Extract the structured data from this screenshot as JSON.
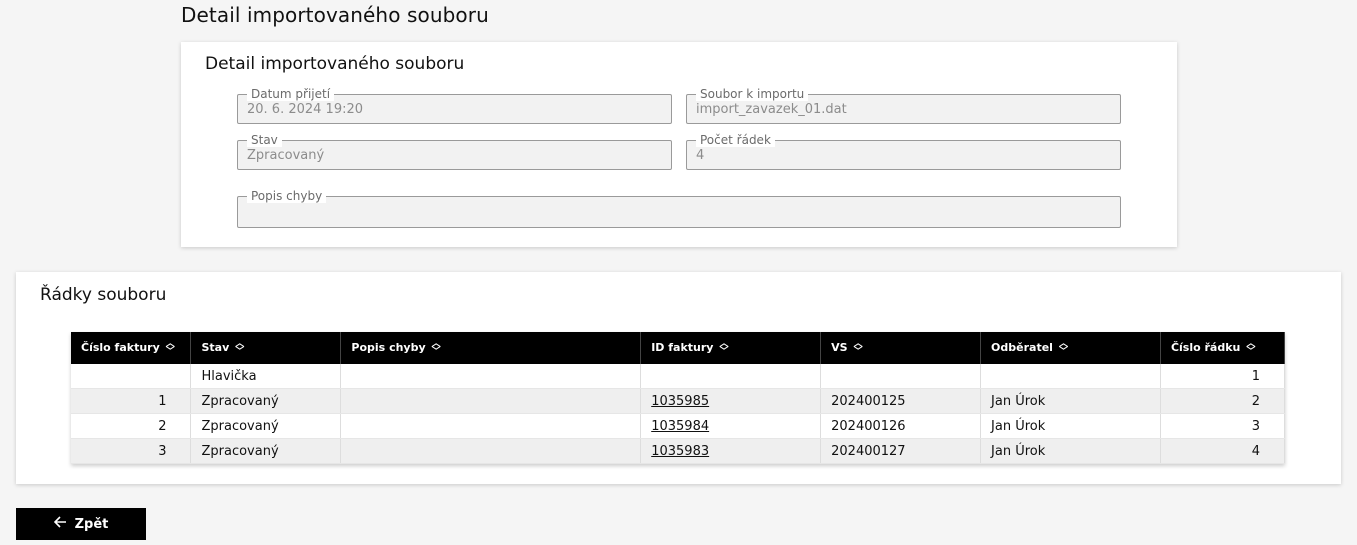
{
  "page": {
    "title": "Detail importovaného souboru"
  },
  "detail": {
    "title": "Detail importovaného souboru",
    "fields": {
      "datum_prijeti": {
        "label": "Datum přijetí",
        "value": "20. 6. 2024 19:20"
      },
      "soubor_k_importu": {
        "label": "Soubor k importu",
        "value": "import_zavazek_01.dat"
      },
      "stav": {
        "label": "Stav",
        "value": "Zpracovaný"
      },
      "pocet_radek": {
        "label": "Počet řádek",
        "value": "4"
      },
      "popis_chyby": {
        "label": "Popis chyby",
        "value": ""
      }
    }
  },
  "rows": {
    "title": "Řádky souboru",
    "columns": [
      "Číslo faktury",
      "Stav",
      "Popis chyby",
      "ID faktury",
      "VS",
      "Odběratel",
      "Číslo řádku"
    ],
    "data": [
      {
        "cislo_faktury": "",
        "stav": "Hlavička",
        "popis_chyby": "",
        "id_faktury": "",
        "vs": "",
        "odberatel": "",
        "cislo_radku": "1"
      },
      {
        "cislo_faktury": "1",
        "stav": "Zpracovaný",
        "popis_chyby": "",
        "id_faktury": "1035985",
        "vs": "202400125",
        "odberatel": "Jan Úrok",
        "cislo_radku": "2"
      },
      {
        "cislo_faktury": "2",
        "stav": "Zpracovaný",
        "popis_chyby": "",
        "id_faktury": "1035984",
        "vs": "202400126",
        "odberatel": "Jan Úrok",
        "cislo_radku": "3"
      },
      {
        "cislo_faktury": "3",
        "stav": "Zpracovaný",
        "popis_chyby": "",
        "id_faktury": "1035983",
        "vs": "202400127",
        "odberatel": "Jan Úrok",
        "cislo_radku": "4"
      }
    ]
  },
  "back_button": {
    "label": "Zpět",
    "icon": "arrow-left-icon"
  }
}
